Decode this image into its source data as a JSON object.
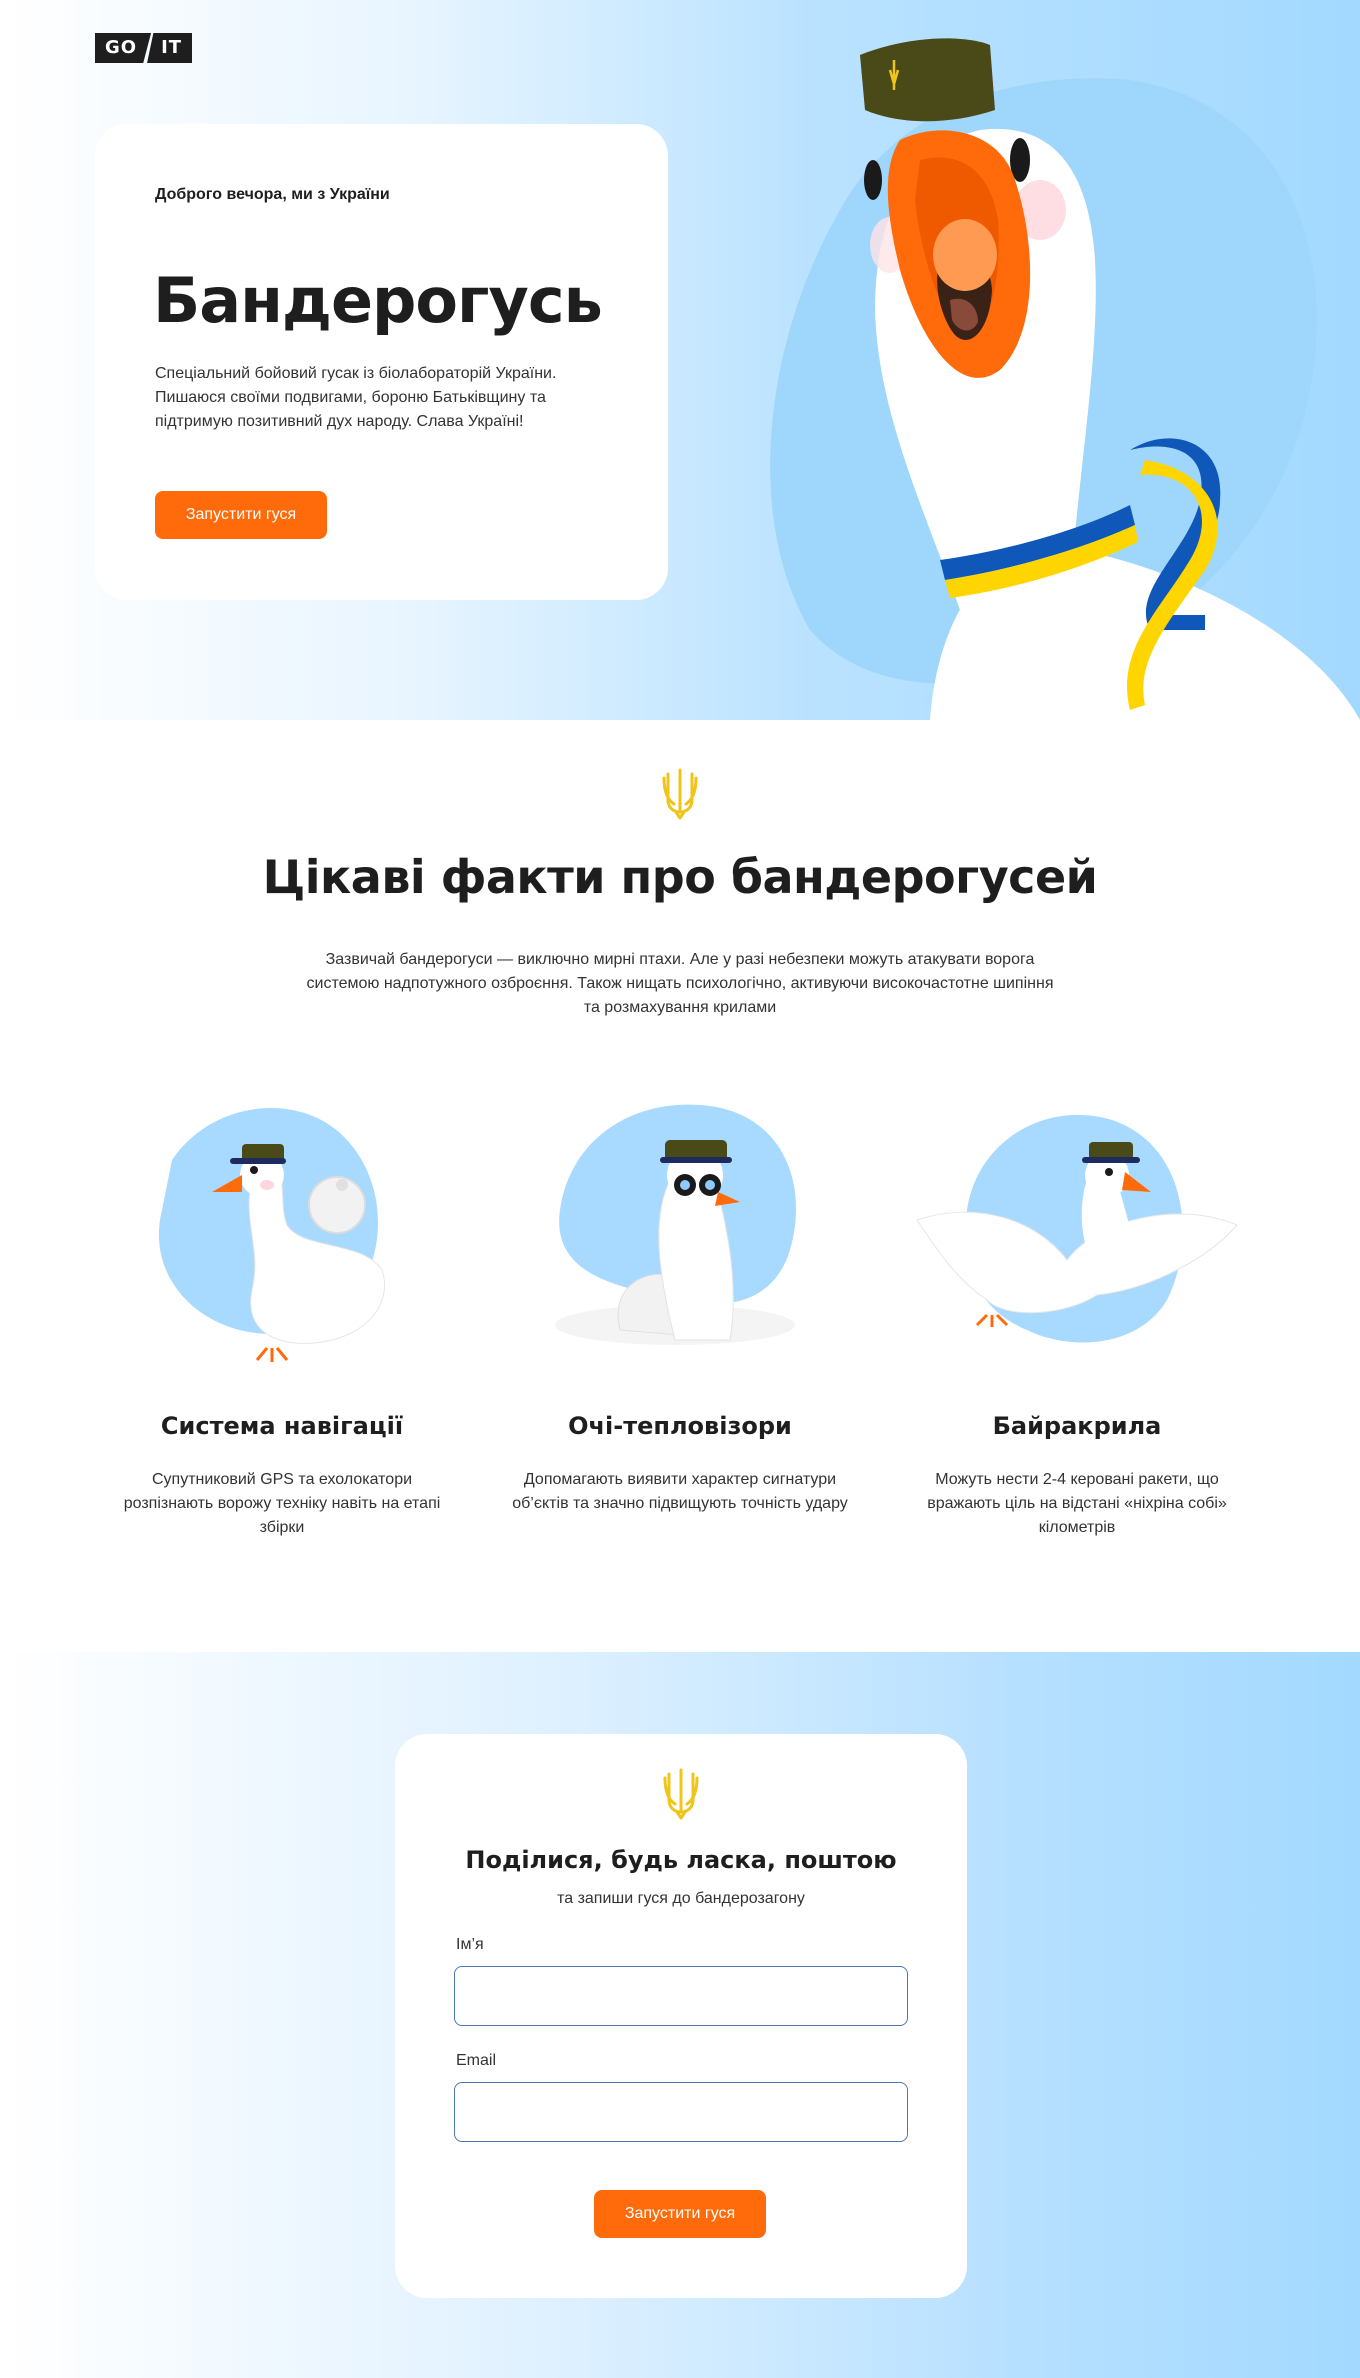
{
  "brand": {
    "logo_left": "GO",
    "logo_right": "IT"
  },
  "hero": {
    "greeting": "Доброго вечора, ми з України",
    "title": "Бандерогусь",
    "description": "Спеціальний бойовий гусак із біолабораторій України. Пишаюся своїми подвигами, бороню Батьківщину та підтримую позитивний дух народу. Слава Україні!",
    "button_label": "Запустити гуся"
  },
  "facts": {
    "title": "Цікаві факти про бандерогусей",
    "description": "Зазвичай бандерогуси — виключно мирні птахи. Але у разі небезпеки можуть атакувати ворога системою надпотужного озброєння. Також нищать психологічно, активуючи високочастотне шипіння та розмахування крилами",
    "items": [
      {
        "title": "Система навігації",
        "description": "Супутниковий GPS та ехолокатори розпізнають ворожу техніку навіть на етапі збірки"
      },
      {
        "title": "Очі-тепловізори",
        "description": "Допомагають виявити характер сигнатури об’єктів та значно підвищують точність удару"
      },
      {
        "title": "Байракрила",
        "description": "Можуть нести 2-4 керовані ракети, що вражають ціль на відстані «ніхріна собі» кілометрів"
      }
    ]
  },
  "subscribe": {
    "title": "Поділися, будь ласка, поштою",
    "subtitle": "та запиши гуся до бандерозагону",
    "name_label": "Ім’я",
    "name_value": "",
    "email_label": "Email",
    "email_value": "",
    "button_label": "Запустити гуся"
  },
  "colors": {
    "accent": "#ff6b0a",
    "sky": "#a3d9ff",
    "blob": "#9fd6fb",
    "text": "#1e1e1e",
    "trident": "#f0c419",
    "flag_blue": "#0f57b8",
    "flag_yellow": "#ffd500",
    "cap": "#4a4a18"
  },
  "icons": {
    "trident": "trident-icon",
    "logo": "goit-logo"
  }
}
